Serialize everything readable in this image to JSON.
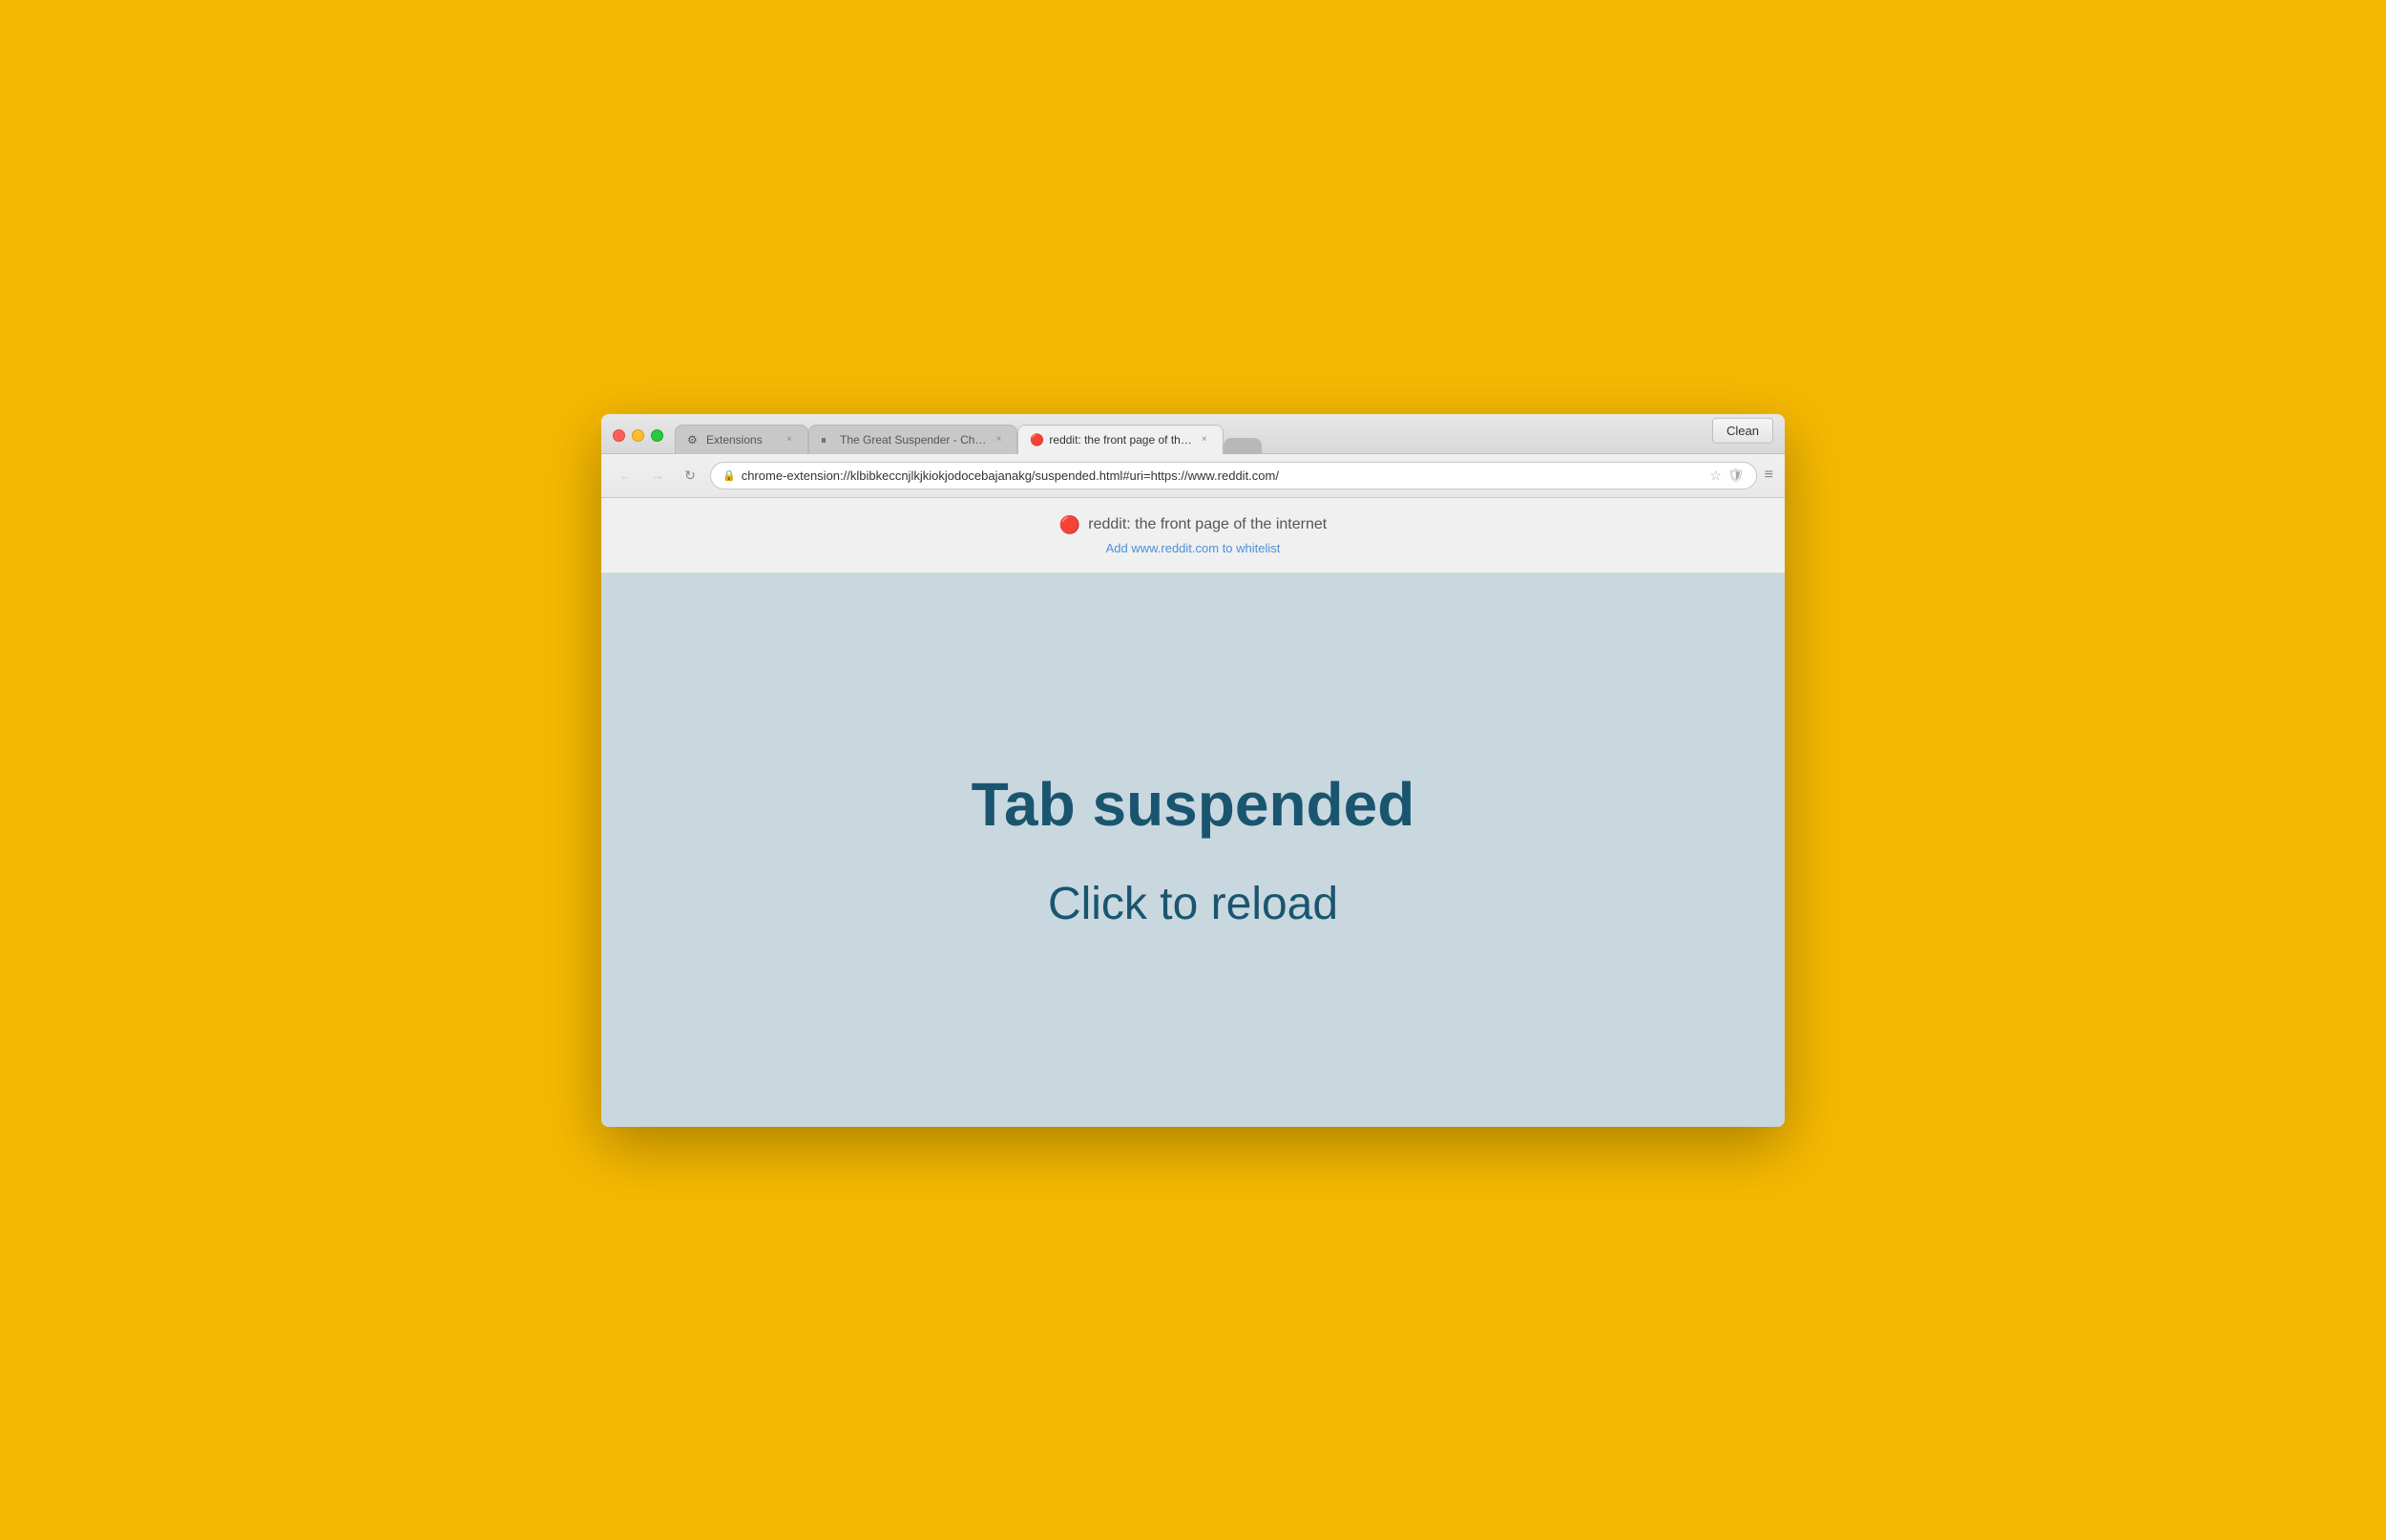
{
  "browser": {
    "clean_button": "Clean",
    "tabs": [
      {
        "id": "extensions",
        "label": "Extensions",
        "favicon": "⚙",
        "active": false
      },
      {
        "id": "great-suspender",
        "label": "The Great Suspender - Ch…",
        "favicon": "⏸",
        "active": false
      },
      {
        "id": "reddit",
        "label": "reddit: the front page of th…",
        "favicon": "🔴",
        "active": true
      }
    ],
    "address_bar": {
      "url": "chrome-extension://klbibkeccnjlkjkiokjodocebajanakg/suspended.html#uri=https://www.reddit.com/",
      "icon": "🔒"
    },
    "nav": {
      "back": "←",
      "forward": "→",
      "reload": "↻"
    }
  },
  "page_header": {
    "site_icon": "🔴",
    "site_title": "reddit: the front page of the internet",
    "whitelist_link_text": "Add www.reddit.com to whitelist",
    "whitelist_url": "#"
  },
  "main_content": {
    "suspended_heading": "Tab suspended",
    "reload_text": "Click to reload"
  }
}
